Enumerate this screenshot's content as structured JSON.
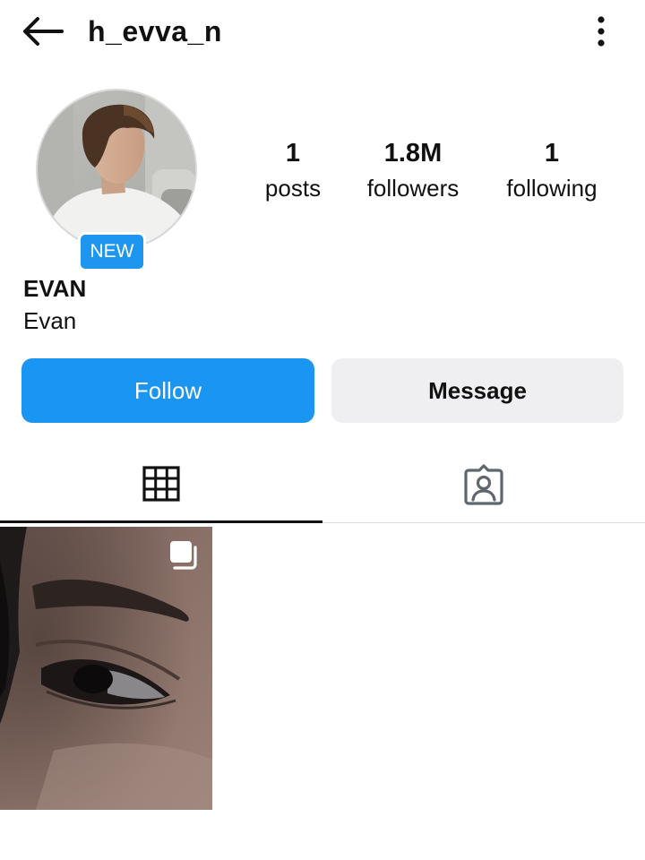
{
  "header": {
    "username": "h_evva_n",
    "back_icon": "back-arrow-icon",
    "more_icon": "more-options-icon"
  },
  "profile": {
    "badge": "NEW",
    "display_name": "EVAN",
    "bio_name": "Evan"
  },
  "stats": {
    "posts": {
      "value": "1",
      "label": "posts"
    },
    "followers": {
      "value": "1.8M",
      "label": "followers"
    },
    "following": {
      "value": "1",
      "label": "following"
    }
  },
  "actions": {
    "follow_label": "Follow",
    "message_label": "Message"
  },
  "tabs": [
    {
      "name": "posts-grid",
      "icon": "grid-icon",
      "active": true
    },
    {
      "name": "tagged",
      "icon": "tagged-person-icon",
      "active": false
    }
  ],
  "posts": [
    {
      "type": "carousel",
      "icon": "multiple-photos-icon"
    }
  ],
  "colors": {
    "accent": "#1b95f2",
    "badge": "#1d96f0",
    "secondary_button": "#efeff1",
    "text": "#111111"
  }
}
